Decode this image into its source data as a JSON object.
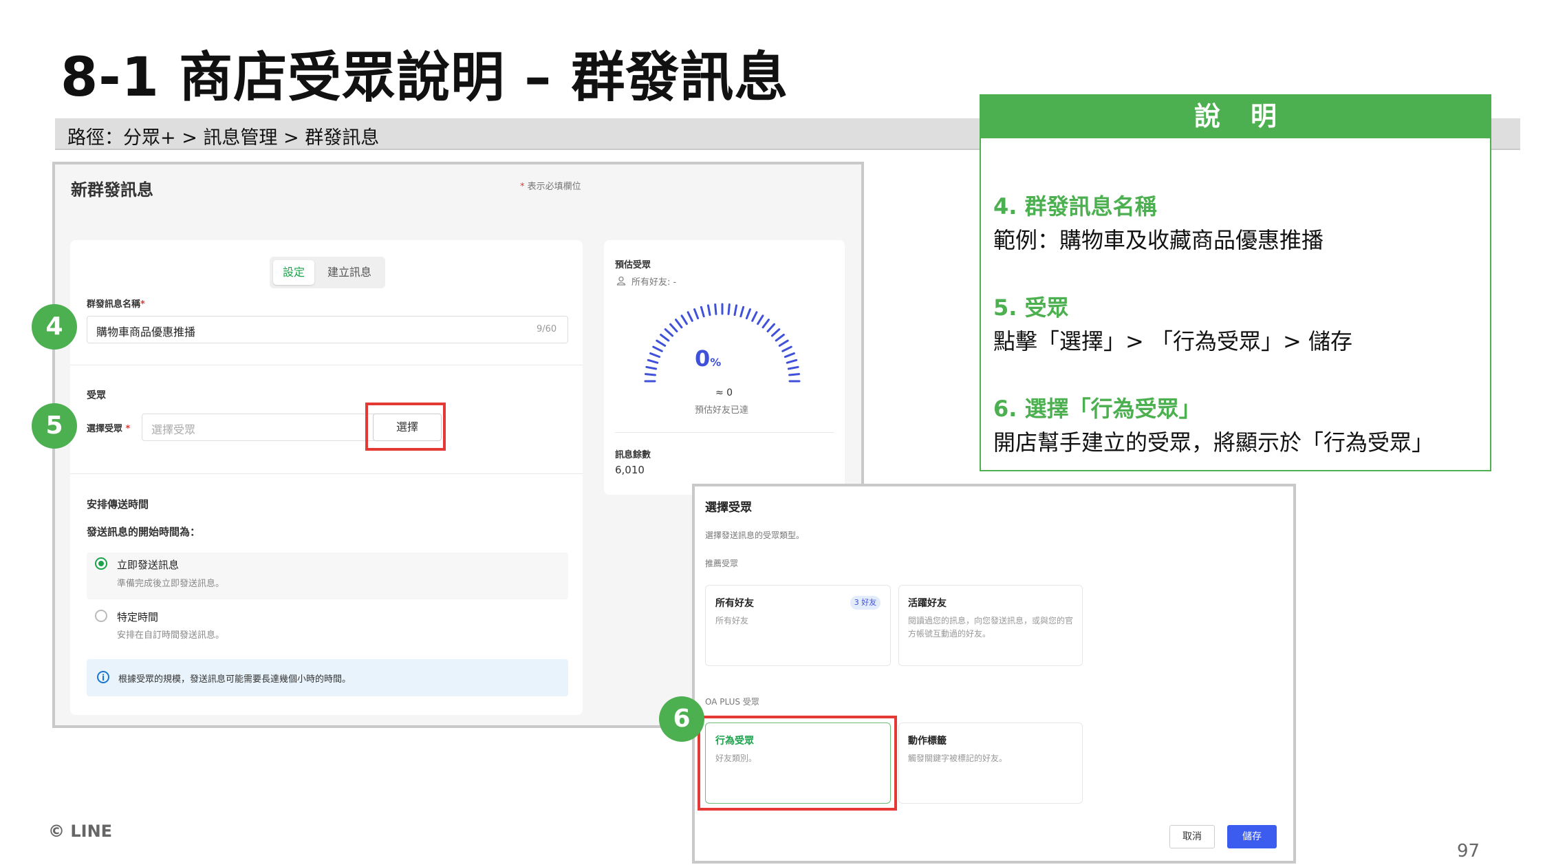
{
  "slide": {
    "title": "8-1 商店受眾說明 – 群發訊息",
    "path": "路徑：分眾+ > 訊息管理 > 群發訊息",
    "footer_logo": "© LINE",
    "page_number": "97"
  },
  "form": {
    "page_title": "新群發訊息",
    "required_note": "表示必填欄位",
    "required_mark": "*",
    "tabs": [
      {
        "label": "設定",
        "active": true
      },
      {
        "label": "建立訊息",
        "active": false
      }
    ],
    "name_label": "群發訊息名稱",
    "name_value": "購物車商品優惠推播",
    "name_count": "9/60",
    "audience_section": "受眾",
    "audience_label": "選擇受眾",
    "audience_placeholder": "選擇受眾",
    "select_button": "選擇",
    "schedule_section": "安排傳送時間",
    "schedule_question": "發送訊息的開始時間為：",
    "options": [
      {
        "title": "立即發送訊息",
        "desc": "準備完成後立即發送訊息。",
        "selected": true
      },
      {
        "title": "特定時間",
        "desc": "安排在自訂時間發送訊息。",
        "selected": false
      }
    ],
    "info_icon": "info-icon",
    "info_text": "根據受眾的規模，發送訊息可能需要長達幾個小時的時間。"
  },
  "estimate": {
    "title": "預估受眾",
    "all_friends": "所有好友: -",
    "gauge_value": "0",
    "gauge_unit": "%",
    "approx": "≈ 0",
    "reach_label": "預估好友已達",
    "remaining_title": "訊息餘數",
    "remaining_value": "6,010",
    "accent_color": "#3f51d8"
  },
  "callouts": [
    "4",
    "5",
    "6"
  ],
  "explanation": {
    "header": "說明",
    "items": [
      {
        "heading": "4. 群發訊息名稱",
        "body": "範例：購物車及收藏商品優惠推播"
      },
      {
        "heading": "5. 受眾",
        "body": "點擊「選擇」> 「行為受眾」> 儲存"
      },
      {
        "heading": "6. 選擇「行為受眾」",
        "body": "開店幫手建立的受眾，將顯示於「行為受眾」"
      }
    ],
    "accent_color": "#4caf50"
  },
  "dialog": {
    "title": "選擇受眾",
    "subtitle": "選擇發送訊息的受眾類型。",
    "recommended_section": "推薦受眾",
    "cards_recommended": [
      {
        "title": "所有好友",
        "badge": "3 好友",
        "desc": "所有好友"
      },
      {
        "title": "活躍好友",
        "desc": "閱讀過您的訊息，向您發送訊息，或與您的官方帳號互動過的好友。"
      }
    ],
    "oa_section": "OA PLUS 受眾",
    "cards_oa": [
      {
        "title": "行為受眾",
        "desc": "好友類別。",
        "selected": true
      },
      {
        "title": "動作標籤",
        "desc": "觸發關鍵字被標記的好友。"
      }
    ],
    "cancel_button": "取消",
    "save_button": "儲存"
  }
}
